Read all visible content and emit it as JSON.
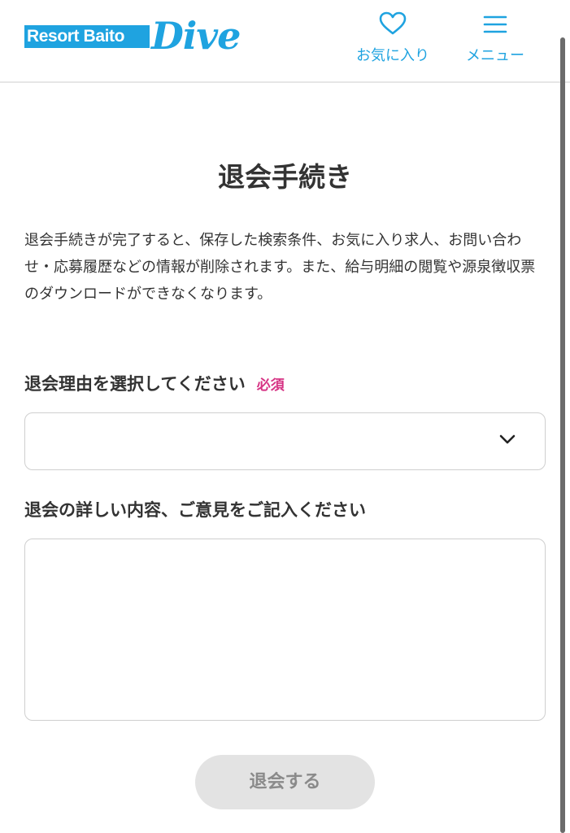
{
  "header": {
    "logo_text": "Resort Baito",
    "logo_script": "Dive",
    "favorites_label": "お気に入り",
    "menu_label": "メニュー"
  },
  "page": {
    "title": "退会手続き",
    "notice": "退会手続きが完了すると、保存した検索条件、お気に入り求人、お問い合わせ・応募履歴などの情報が削除されます。また、給与明細の閲覧や源泉徴収票のダウンロードができなくなります。"
  },
  "form": {
    "reason_label": "退会理由を選択してください",
    "required_badge": "必須",
    "reason_value": "",
    "detail_label": "退会の詳しい内容、ご意見をご記入ください",
    "detail_value": "",
    "submit_label": "退会する"
  },
  "icons": {
    "favorites": "heart-icon",
    "menu": "hamburger-icon",
    "select": "chevron-down-icon"
  },
  "colors": {
    "brand": "#1fa3e0",
    "required": "#d63384",
    "button_disabled_bg": "#e3e3e3",
    "button_disabled_text": "#8a8a8a"
  }
}
